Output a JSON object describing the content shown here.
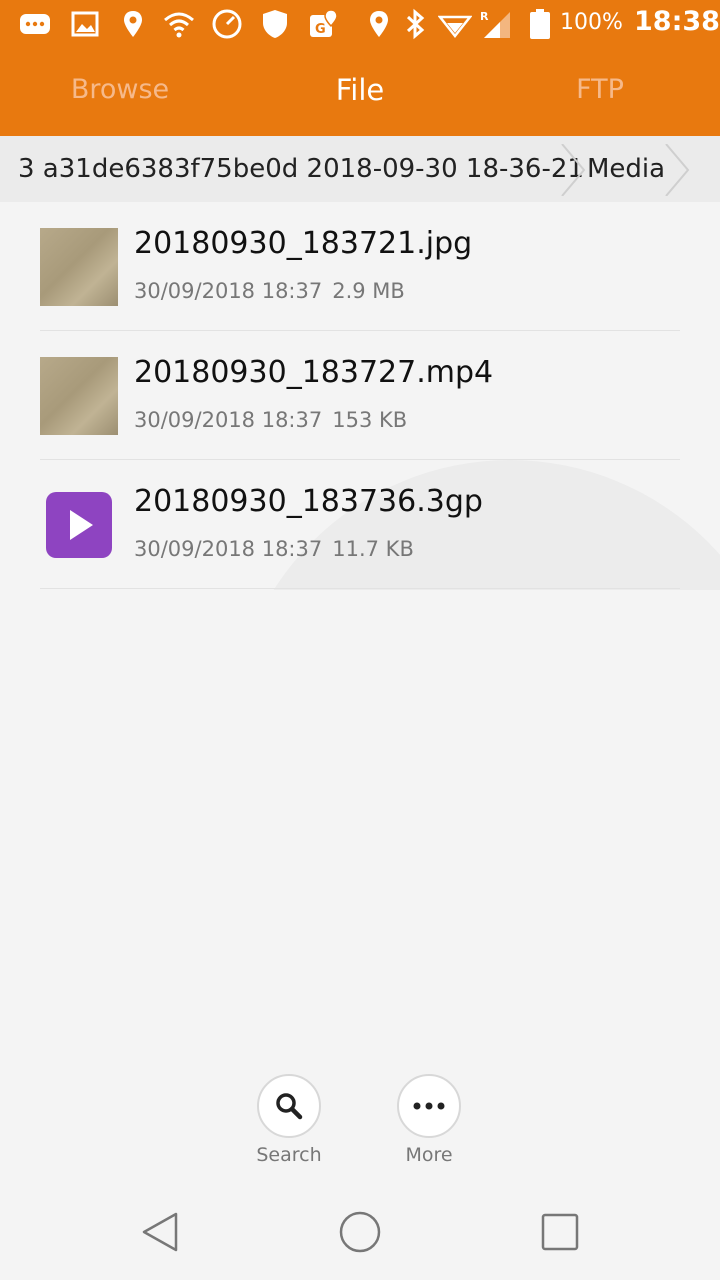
{
  "status_bar": {
    "battery": "100%",
    "time": "18:38"
  },
  "tabs": [
    {
      "label": "Browse",
      "active": false
    },
    {
      "label": "File",
      "active": true
    },
    {
      "label": "FTP",
      "active": false
    }
  ],
  "breadcrumb": [
    {
      "label": "3 a31de6383f75be0d 2018-09-30 18-36-21"
    },
    {
      "label": "Media"
    }
  ],
  "files": [
    {
      "name": "20180930_183721.jpg",
      "date": "30/09/2018 18:37",
      "size": "2.9 MB",
      "icon": "image-thumbnail"
    },
    {
      "name": "20180930_183727.mp4",
      "date": "30/09/2018 18:37",
      "size": "153 KB",
      "icon": "video-thumbnail"
    },
    {
      "name": "20180930_183736.3gp",
      "date": "30/09/2018 18:37",
      "size": "11.7 KB",
      "icon": "play-icon"
    }
  ],
  "actions": {
    "search": "Search",
    "more": "More"
  },
  "colors": {
    "accent": "#e8790f",
    "play_icon": "#8e44c1"
  }
}
